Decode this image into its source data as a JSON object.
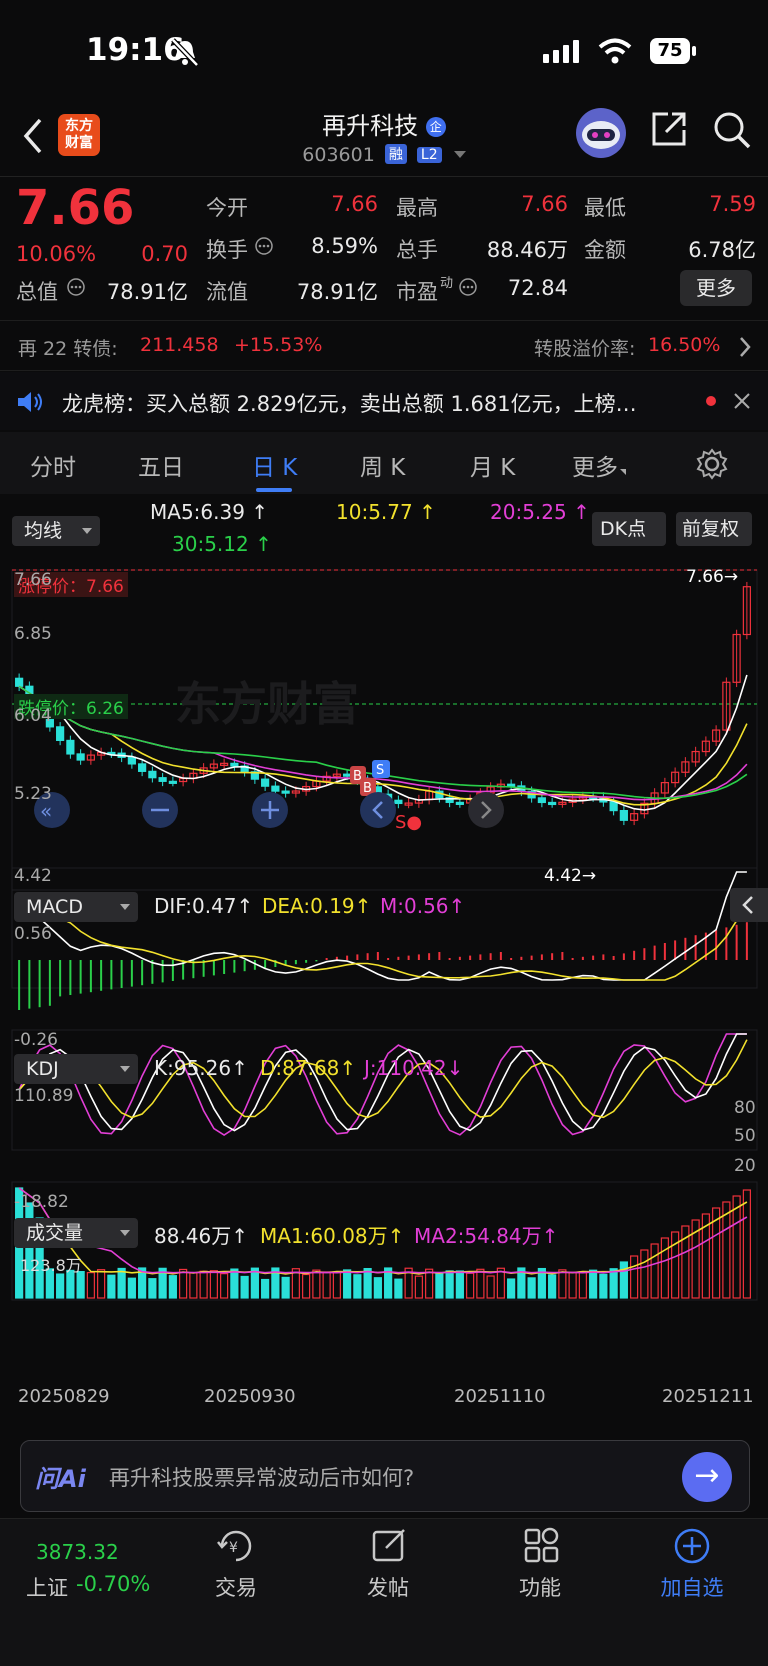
{
  "status_bar": {
    "time": "19:16",
    "battery": "75"
  },
  "header": {
    "logo_text_1": "东方",
    "logo_text_2": "财富",
    "title": "再升科技",
    "title_badge": "企",
    "code": "603601",
    "tag_rong": "融",
    "tag_l2": "L2"
  },
  "quote": {
    "price": "7.66",
    "change_pct": "10.06%",
    "change_amt": "0.70",
    "items": [
      {
        "label": "今开",
        "value": "7.66",
        "color": "red"
      },
      {
        "label": "最高",
        "value": "7.66",
        "color": "red"
      },
      {
        "label": "最低",
        "value": "7.59",
        "color": "red"
      },
      {
        "label": "换手",
        "value": "8.59%",
        "color": "white"
      },
      {
        "label": "总手",
        "value": "88.46万",
        "color": "white"
      },
      {
        "label": "金额",
        "value": "6.78亿",
        "color": "white"
      },
      {
        "label": "总值",
        "value": "78.91亿",
        "color": "white"
      },
      {
        "label": "流值",
        "value": "78.91亿",
        "color": "white"
      },
      {
        "label": "市盈",
        "value": "72.84",
        "color": "white"
      }
    ],
    "more_button": "更多"
  },
  "convertible": {
    "name": "再 22 转债:",
    "price": "211.458",
    "pct": "+15.53%",
    "premium_label": "转股溢价率:",
    "premium": "16.50%"
  },
  "dragon": {
    "text": "龙虎榜：买入总额 2.829亿元，卖出总额 1.681亿元，上榜…"
  },
  "tabs": [
    "分时",
    "五日",
    "日 K",
    "周 K",
    "月 K",
    "更多"
  ],
  "active_tab": 2,
  "ma_panel": {
    "selector": "均线",
    "ma5": "MA5:6.39",
    "ma10": "10:5.77",
    "ma20": "20:5.25",
    "ma30": "30:5.12",
    "dk_button": "DK点",
    "fq_button": "前复权"
  },
  "kline": {
    "watermark": "东方财富",
    "limit_up_label": "涨停价：7.66",
    "limit_down_label": "跌停价：6.26",
    "axis": [
      "7.66",
      "6.85",
      "6.04",
      "5.23",
      "4.42"
    ],
    "max_mark": "7.66",
    "min_mark": "4.42",
    "dates": [
      "20250829",
      "20250930",
      "20251110",
      "20251211"
    ]
  },
  "macd": {
    "selector": "MACD",
    "dif": "DIF:0.47",
    "dea": "DEA:0.19",
    "m": "M:0.56",
    "axis_top": "0.56",
    "axis_bottom": "-0.26"
  },
  "kdj": {
    "selector": "KDJ",
    "k": "K:95.26",
    "d": "D:87.68",
    "j": "J:110.42",
    "axis_top": "110.89",
    "axis_bottom": "-18.82",
    "levels": [
      "80",
      "50",
      "20"
    ]
  },
  "volume": {
    "selector": "成交量",
    "vol": "88.46万",
    "ma1": "MA1:60.08万",
    "ma2": "MA2:54.84万",
    "axis_top": "123.8万"
  },
  "ai_bar": {
    "brand": "问Ai",
    "prompt": "再升科技股票异常波动后市如何?"
  },
  "bottom_nav": {
    "index_value": "3873.32",
    "index_name": "上证",
    "index_pct": "-0.70%",
    "items": [
      "交易",
      "发帖",
      "功能",
      "加自选"
    ]
  },
  "colors": {
    "up": "#f0323c",
    "down": "#2ae0d8",
    "accent": "#3f7df6",
    "ma5": "#ffffff",
    "ma10": "#f2e12d",
    "ma20": "#e23fd6",
    "ma30": "#2ad04a"
  }
}
